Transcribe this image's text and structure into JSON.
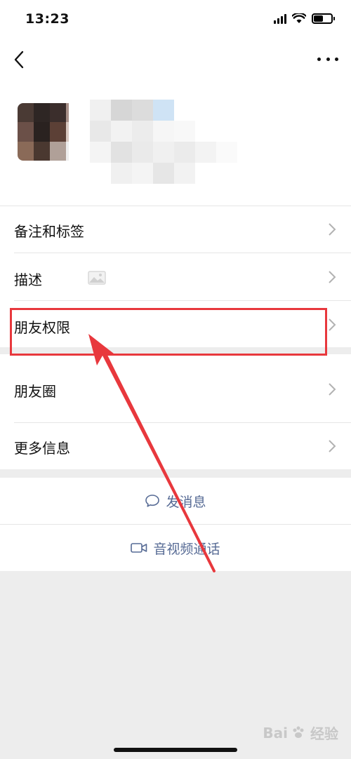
{
  "status_bar": {
    "time": "13:23",
    "battery_level": 0.55
  },
  "nav": {
    "back_icon": "chevron-left-icon",
    "more_icon": "more-dots-icon"
  },
  "menu_items": [
    {
      "label": "备注和标签"
    },
    {
      "label": "描述"
    },
    {
      "label": "朋友权限"
    },
    {
      "label": "朋友圈"
    },
    {
      "label": "更多信息"
    }
  ],
  "actions": {
    "message": "发消息",
    "call": "音视频通话"
  },
  "watermark": {
    "text": "Bai",
    "suffix": "经验"
  },
  "colors": {
    "link": "#576b95",
    "highlight": "#e8383d",
    "background": "#ededed"
  }
}
